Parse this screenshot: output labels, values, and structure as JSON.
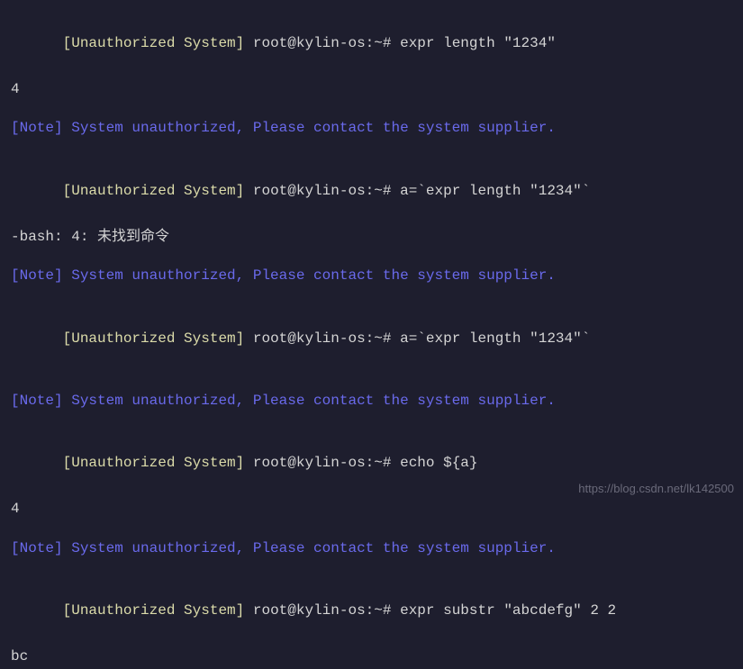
{
  "terminal": {
    "unauthorized_prefix": "[Unauthorized System]",
    "note_line": "[Note] System unauthorized, Please contact the system supplier.",
    "prompt": "root@kylin-os:~#",
    "blocks": [
      {
        "command": "expr length \"1234\"",
        "output": "4"
      },
      {
        "command": "a=`expr length \"1234\"`",
        "output": "-bash: 4: 未找到命令"
      },
      {
        "command": "a=`expr length \"1234\"`",
        "output": ""
      },
      {
        "command": "echo ${a}",
        "output": "4"
      },
      {
        "command": "expr substr \"abcdefg\" 2 2",
        "output": "bc"
      }
    ]
  },
  "watermark": "https://blog.csdn.net/lk142500"
}
